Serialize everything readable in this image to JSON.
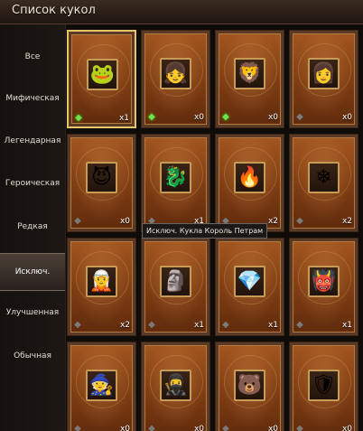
{
  "window": {
    "title": "Список кукол"
  },
  "sidebar": {
    "items": [
      {
        "label": "Все"
      },
      {
        "label": "Мифическая"
      },
      {
        "label": "Легендарная"
      },
      {
        "label": "Героическая"
      },
      {
        "label": "Редкая"
      },
      {
        "label": "Исключ.",
        "active": true
      },
      {
        "label": "Улучшенная"
      },
      {
        "label": "Обычная"
      }
    ]
  },
  "tooltip": {
    "text": "Исключ. Кукла Король Петрам"
  },
  "dolls": [
    {
      "icon": "frog-doll-icon",
      "glyph": "🐸",
      "gem": "green-gem-icon",
      "count": "x1",
      "selected": true
    },
    {
      "icon": "dark-girl-doll-icon",
      "glyph": "👧",
      "gem": "green-gem-icon",
      "count": "x0"
    },
    {
      "icon": "armored-beast-doll-icon",
      "glyph": "🦁",
      "gem": "green-gem-icon",
      "count": "x0"
    },
    {
      "icon": "white-hair-girl-doll-icon",
      "glyph": "👩",
      "gem": "gray-gem-icon",
      "count": "x0"
    },
    {
      "icon": "red-demon-doll-icon",
      "glyph": "😈",
      "gem": "gray-gem-icon",
      "count": "x0"
    },
    {
      "icon": "blue-dragon-doll-icon",
      "glyph": "🐉",
      "gem": "gray-gem-icon",
      "count": "x1"
    },
    {
      "icon": "fire-spirit-doll-icon",
      "glyph": "🔥",
      "gem": "gray-gem-icon",
      "count": "x2"
    },
    {
      "icon": "ice-spirit-doll-icon",
      "glyph": "❄",
      "gem": "gray-gem-icon",
      "count": "x2"
    },
    {
      "icon": "blue-elf-doll-icon",
      "glyph": "🧝",
      "gem": "gray-gem-icon",
      "count": "x2"
    },
    {
      "icon": "rock-golem-doll-icon",
      "glyph": "🗿",
      "gem": "gray-gem-icon",
      "count": "x1"
    },
    {
      "icon": "crystal-spirit-doll-icon",
      "glyph": "💎",
      "gem": "gray-gem-icon",
      "count": "x1"
    },
    {
      "icon": "red-imp-doll-icon",
      "glyph": "👹",
      "gem": "gray-gem-icon",
      "count": "x1"
    },
    {
      "icon": "white-hair-warrior-doll-icon",
      "glyph": "🧙",
      "gem": "gray-gem-icon",
      "count": "x0"
    },
    {
      "icon": "masked-fighter-doll-icon",
      "glyph": "🥷",
      "gem": "gray-gem-icon",
      "count": "x0"
    },
    {
      "icon": "furry-creature-doll-icon",
      "glyph": "🐻",
      "gem": "gray-gem-icon",
      "count": "x0"
    },
    {
      "icon": "armored-knight-doll-icon",
      "glyph": "🛡",
      "gem": "gray-gem-icon",
      "count": "x0"
    }
  ]
}
